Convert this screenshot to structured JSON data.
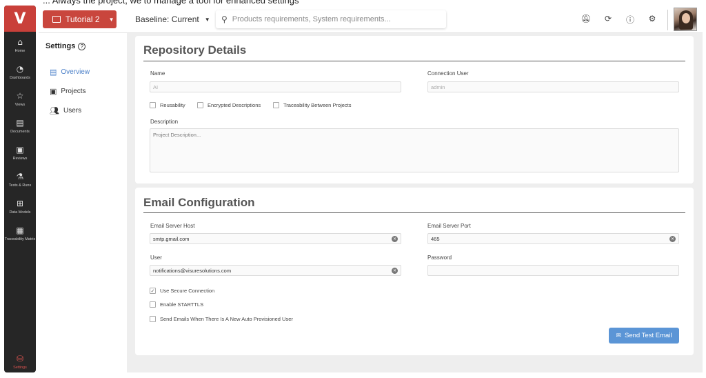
{
  "clipped_caption": "... Always the       project, we        to manage a tool for enhanced settings",
  "rail": {
    "logo": "V",
    "items": [
      {
        "icon": "home-icon",
        "glyph": "⌂",
        "label": "Home"
      },
      {
        "icon": "dashboards-icon",
        "glyph": "◔",
        "label": "Dashboards"
      },
      {
        "icon": "views-icon",
        "glyph": "☆",
        "label": "Views"
      },
      {
        "icon": "documents-icon",
        "glyph": "▤",
        "label": "Documents"
      },
      {
        "icon": "reviews-icon",
        "glyph": "▣",
        "label": "Reviews"
      },
      {
        "icon": "tests-icon",
        "glyph": "⚗",
        "label": "Tests & Runs"
      },
      {
        "icon": "data-models-icon",
        "glyph": "⊞",
        "label": "Data Models"
      },
      {
        "icon": "traceability-icon",
        "glyph": "▦",
        "label": "Traceability Matrix"
      }
    ],
    "settings": {
      "icon": "database-icon",
      "glyph": "⛁",
      "label": "Settings",
      "color": "#d9534f"
    }
  },
  "topbar": {
    "project": "Tutorial 2",
    "baseline": "Baseline: Current",
    "search_placeholder": "Products requirements, System requirements..."
  },
  "settings_nav": {
    "title": "Settings",
    "items": [
      {
        "label": "Overview",
        "active": true,
        "icon": "overview-icon"
      },
      {
        "label": "Projects",
        "active": false,
        "icon": "projects-icon"
      },
      {
        "label": "Users",
        "active": false,
        "icon": "users-icon"
      }
    ]
  },
  "repository": {
    "title": "Repository Details",
    "name_label": "Name",
    "name_value": "AI",
    "connection_user_label": "Connection User",
    "connection_user_value": "admin",
    "checkboxes": [
      {
        "label": "Reusability",
        "checked": false
      },
      {
        "label": "Encrypted Descriptions",
        "checked": false
      },
      {
        "label": "Traceability Between Projects",
        "checked": false
      }
    ],
    "description_label": "Description",
    "description_placeholder": "Project Description..."
  },
  "email": {
    "title": "Email Configuration",
    "host_label": "Email Server Host",
    "host_value": "smtp.gmail.com",
    "port_label": "Email Server Port",
    "port_value": "465",
    "user_label": "User",
    "user_value": "notifications@visuresolutions.com",
    "password_label": "Password",
    "password_value": "",
    "checkboxes": [
      {
        "label": "Use Secure Connection",
        "checked": true
      },
      {
        "label": "Enable STARTTLS",
        "checked": false
      },
      {
        "label": "Send Emails When There Is A New Auto Provisioned User",
        "checked": false
      }
    ],
    "send_button": "Send Test Email"
  },
  "colors": {
    "brand_red": "#c9463d",
    "accent_blue": "#5b95d6",
    "active_nav": "#4a7fc8"
  }
}
